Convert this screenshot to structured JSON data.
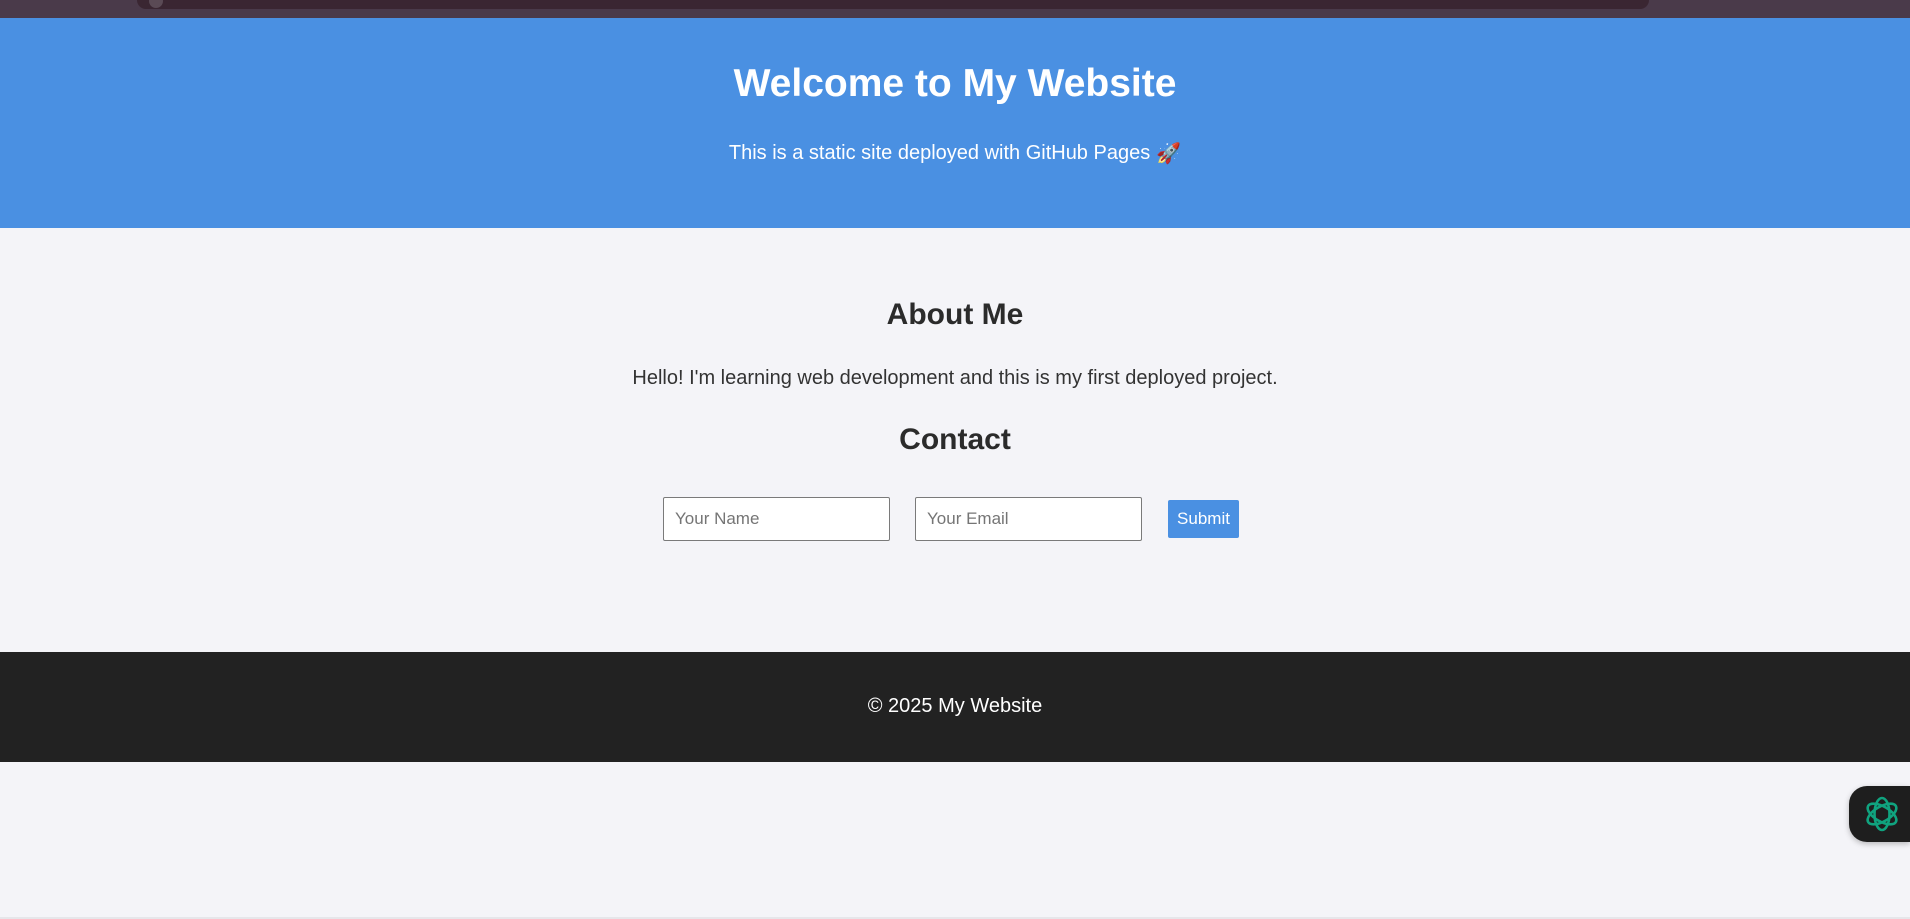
{
  "colors": {
    "hero_bg": "#4a90e2",
    "footer_bg": "#222222",
    "page_bg": "#f4f4f8",
    "button_bg": "#4a90e2",
    "assistant_icon": "#10a37f"
  },
  "hero": {
    "title": "Welcome to My Website",
    "subtitle": "This is a static site deployed with GitHub Pages",
    "subtitle_emoji": "🚀"
  },
  "about": {
    "heading": "About Me",
    "text": "Hello! I'm learning web development and this is my first deployed project."
  },
  "contact": {
    "heading": "Contact",
    "name_placeholder": "Your Name",
    "name_value": "",
    "email_placeholder": "Your Email",
    "email_value": "",
    "submit_label": "Submit"
  },
  "footer": {
    "text": "© 2025 My Website"
  },
  "assistant": {
    "icon": "openai-logo-icon"
  }
}
